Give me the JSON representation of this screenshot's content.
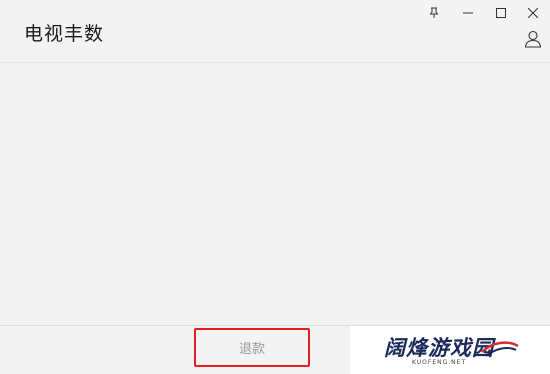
{
  "window": {
    "title": "电视丰数"
  },
  "titlebar": {
    "buttons": [
      {
        "name": "pin",
        "icon": "pin-icon"
      },
      {
        "name": "minimize",
        "icon": "minimize-icon"
      },
      {
        "name": "maximize",
        "icon": "maximize-icon"
      },
      {
        "name": "close",
        "icon": "close-icon"
      }
    ],
    "account_icon": "user-icon"
  },
  "footer": {
    "refund_label": "退款"
  },
  "watermark": {
    "text": "阔烽游戏园",
    "subtext": "KUOFENG.NET"
  },
  "colors": {
    "highlight": "#e02020",
    "background": "#f3f3f3",
    "watermark_text": "#1a2a5a"
  }
}
